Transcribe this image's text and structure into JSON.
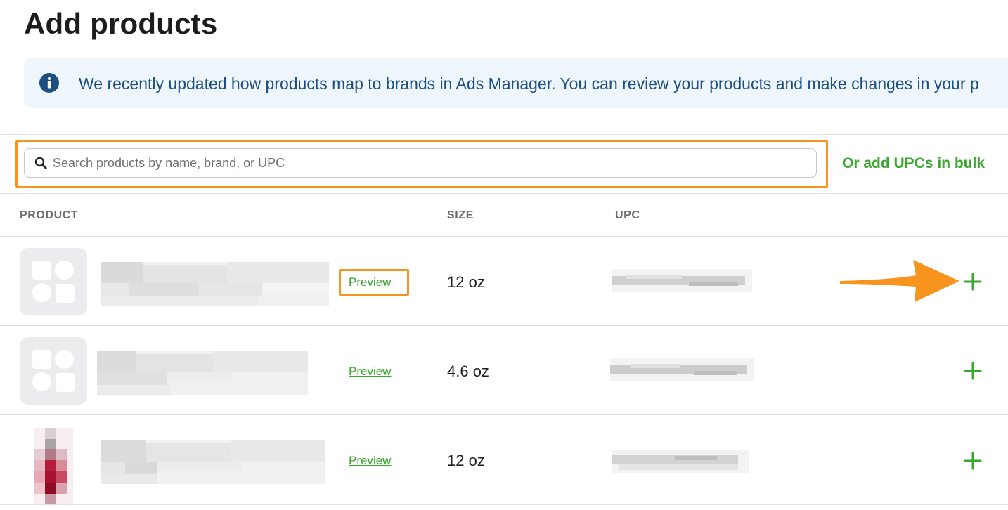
{
  "page": {
    "title": "Add products"
  },
  "banner": {
    "icon": "info-icon",
    "text": "We recently updated how products map to brands in Ads Manager. You can review your products and make changes in your p"
  },
  "search": {
    "icon": "search-icon",
    "placeholder": "Search products by name, brand, or UPC",
    "value": ""
  },
  "bulk_link": "Or add UPCs in bulk",
  "table": {
    "columns": {
      "product": "PRODUCT",
      "size": "SIZE",
      "upc": "UPC"
    },
    "rows": [
      {
        "preview": "Preview",
        "size": "12 oz",
        "thumbnail": "product-placeholder-icon",
        "highlighted": true
      },
      {
        "preview": "Preview",
        "size": "4.6 oz",
        "thumbnail": "product-placeholder-icon",
        "highlighted": false
      },
      {
        "preview": "Preview",
        "size": "12 oz",
        "thumbnail": "product-photo",
        "highlighted": false
      }
    ]
  },
  "colors": {
    "accent_green": "#3aa62e",
    "highlight_orange": "#f7941d",
    "banner_bg": "#eef6fc",
    "banner_text": "#1b4f82"
  }
}
